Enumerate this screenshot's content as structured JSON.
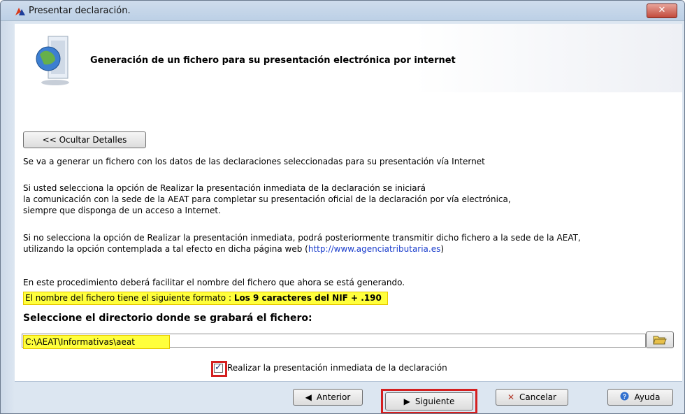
{
  "window": {
    "title": "Presentar declaración.",
    "close_label": "✕"
  },
  "header": {
    "title": "Generación de un fichero para su presentación electrónica por internet"
  },
  "content": {
    "toggle_details_label": "<< Ocultar Detalles",
    "para1": "Se va a generar un fichero con los datos de las declaraciones seleccionadas para su presentación vía Internet",
    "para2_line1": "Si usted selecciona la opción de Realizar la presentación inmediata de la declaración se iniciará",
    "para2_line2": "la comunicación con la sede de la AEAT para completar su presentación oficial de la declaración por vía electrónica,",
    "para2_line3": "siempre que disponga de un acceso a Internet.",
    "para3_line1": "Si no selecciona la opción de Realizar la presentación inmediata, podrá posteriormente transmitir dicho fichero a la sede de la AEAT,",
    "para3_line2_prefix": "utilizando la opción contemplada a tal efecto en dicha página web (",
    "para3_link": "http://www.agenciatributaria.es",
    "para3_line2_suffix": ")",
    "para4": "En este procedimiento deberá facilitar el nombre del fichero que ahora se está generando.",
    "format_prefix": "El nombre del fichero tiene el siguiente formato : ",
    "format_value": "Los 9 caracteres del NIF + .190",
    "dir_label": "Seleccione el directorio donde se grabará el fichero:",
    "dir_value": "C:\\AEAT\\Informativas\\aeat",
    "checkbox_label": "Realizar la presentación inmediata de la declaración",
    "checkbox_checked": true
  },
  "footer": {
    "prev_label": "Anterior",
    "next_label": "Siguiente",
    "cancel_label": "Cancelar",
    "help_label": "Ayuda"
  },
  "icons": {
    "app": "aeat-logo-icon",
    "header": "globe-document-icon",
    "folder": "open-folder-icon",
    "prev": "triangle-left-icon",
    "next": "triangle-right-icon",
    "cancel": "x-icon",
    "help": "question-circle-icon"
  },
  "colors": {
    "highlight": "#ffff3c",
    "annotation_red": "#d42020",
    "link": "#1a3dcc"
  }
}
